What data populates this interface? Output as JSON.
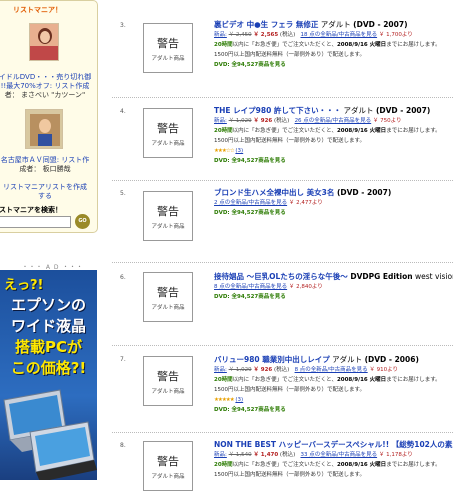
{
  "sidebar": {
    "title": "リストマニア！",
    "list1_title": "イドルDVD・・・売り切れ御",
    "list1_sub": "!!最大70%オフ: リスト作成",
    "list1_author": "者： まさべい \"カツーン\"",
    "list2_title": "名古屋市ＡＶ同盟: リスト作",
    "list2_author": "成者： 板口勝哉",
    "create_link": "リストマニアリストを作成",
    "create_link2": "する",
    "search_label": "ストマニアを検索！",
    "go_label": "GO",
    "ad_label": "・・・ A D ・・・",
    "ad_lines": [
      "えっ?!",
      "エプソンの",
      "ワイド液晶",
      "搭載PCが",
      "この価格?!"
    ]
  },
  "items": [
    {
      "num": "3.",
      "warn": "警告",
      "warn_sub": "アダルト商品",
      "title": "裏ビデオ 中●生 フェラ 無修正",
      "artist": " アダルト ",
      "format": "(DVD - 2007)",
      "new_label": "新品:",
      "old_price": "￥ 2,450",
      "price": "￥ 2,565",
      "tax": "(税込)",
      "offers": "18 点の全新品/中古商品を見る",
      "offer_price": "￥ 1,700より",
      "ship_a": "20時間",
      "ship_b": "以内に「お急ぎ便」でご注文いただくと、",
      "ship_date": "2008/9/16 火曜日",
      "ship_c": "までにお届けします。",
      "free": "1500円以上国内配送料無料（一部例外あり）で配送します。",
      "rating": "",
      "rating_count": "",
      "dvd": "DVD: 全94,527商品を見る"
    },
    {
      "num": "4.",
      "warn": "警告",
      "warn_sub": "アダルト商品",
      "title": "THE レイプ980 許して下さい・・・",
      "artist": " アダルト ",
      "format": "(DVD - 2007)",
      "new_label": "新品:",
      "old_price": "￥ 1,029",
      "price": "￥ 926",
      "tax": "(税込)",
      "offers": "26 点の全新品/中古商品を見る",
      "offer_price": "￥ 750より",
      "ship_a": "20時間",
      "ship_b": "以内に「お急ぎ便」でご注文いただくと、",
      "ship_date": "2008/9/16 火曜日",
      "ship_c": "までにお届けします。",
      "free": "1500円以上国内配送料無料（一部例外あり）で配送します。",
      "rating": "★★★☆☆",
      "rating_count": "(3)",
      "dvd": "DVD: 全94,527商品を見る"
    },
    {
      "num": "5.",
      "warn": "警告",
      "warn_sub": "アダルト商品",
      "title": "ブロンド生ハメ全裸中出し 美女3名",
      "artist": "",
      "format": "(DVD - 2007)",
      "offers_line": "2 点の全新品/中古商品を見る",
      "offer_price": "￥ 2,477より",
      "dvd": "DVD: 全94,527商品を見る"
    },
    {
      "num": "6.",
      "warn": "警告",
      "warn_sub": "アダルト商品",
      "title": "接待娼品 ～巨乳OLたちの淫らな午後～",
      "artist": "",
      "format": "DVDPG Edition",
      "extra": " west vision",
      "offers_line": "8 点の全新品/中古商品を見る",
      "offer_price": "￥ 2,840より",
      "dvd": "DVD: 全94,527商品を見る"
    },
    {
      "num": "7.",
      "warn": "警告",
      "warn_sub": "アダルト商品",
      "title": "バリュー980 職業別中出しレイプ",
      "artist": " アダルト ",
      "format": "(DVD - 2006)",
      "new_label": "新品:",
      "old_price": "￥ 1,029",
      "price": "￥ 926",
      "tax": "(税込)",
      "offers": "8 点の全新品/中古商品を見る",
      "offer_price": "￥ 910より",
      "ship_a": "20時間",
      "ship_b": "以内に「お急ぎ便」でご注文いただくと、",
      "ship_date": "2008/9/16 火曜日",
      "ship_c": "までにお届けします。",
      "free": "1500円以上国内配送料無料（一部例外あり）で配送します。",
      "rating": "★★★★★",
      "rating_count": "(3)",
      "dvd": "DVD: 全94,527商品を見る"
    },
    {
      "num": "8.",
      "warn": "警告",
      "warn_sub": "アダルト商品",
      "title": "NON THE BEST ハッピーバースデースペシャル!! 【総勢102人の素人!",
      "artist": "",
      "format": "",
      "new_label": "新品:",
      "old_price": "￥ 1,540",
      "price": "￥ 1,470",
      "tax": "(税込)",
      "offers": "33 点の全新品/中古商品を見る",
      "offer_price": "￥ 1,178より",
      "ship_a": "20時間",
      "ship_b": "以内に「お急ぎ便」でご注文いただくと、",
      "ship_date": "2008/9/16 火曜日",
      "ship_c": "までにお届けします。",
      "free": "1500円以上国内配送料無料（一部例外あり）で配送します。"
    }
  ]
}
